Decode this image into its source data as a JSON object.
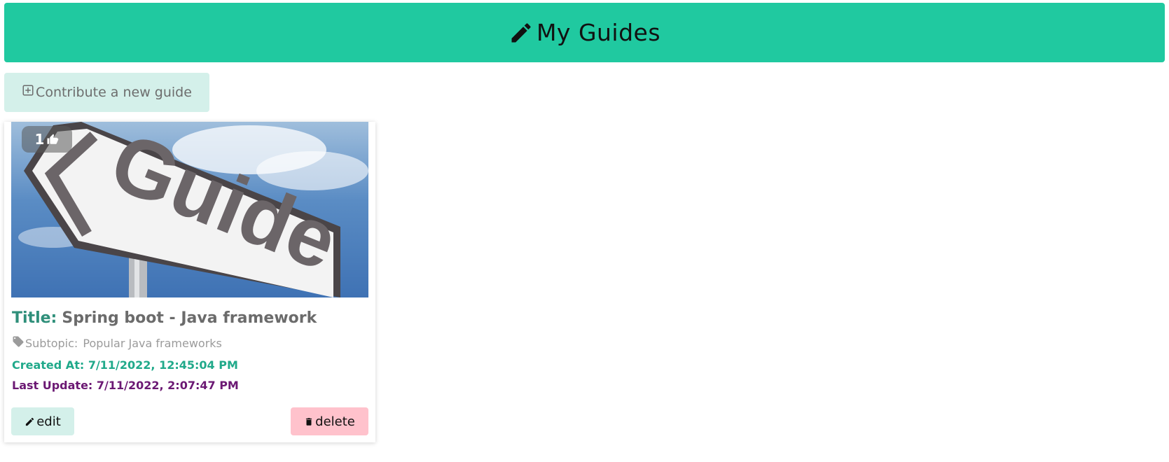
{
  "header": {
    "title": "My Guides",
    "icon": "pencil-icon",
    "background": "#20c9a0"
  },
  "actions": {
    "contribute_label": "Contribute a new guide",
    "contribute_icon": "plus-square-icon"
  },
  "guides": [
    {
      "image_text": "Guide",
      "likes": "1",
      "like_icon": "thumbs-up-icon",
      "title_key": "Title",
      "title_sep": ":",
      "title": "Spring boot - Java framework",
      "subtopic_label": "Subtopic:",
      "subtopic": "Popular Java frameworks",
      "created_label": "Created At:",
      "created_at": "7/11/2022, 12:45:04 PM",
      "updated_label": "Last Update:",
      "updated_at": "7/11/2022, 2:07:47 PM",
      "edit_label": "edit",
      "delete_label": "delete"
    }
  ],
  "colors": {
    "accent": "#20c9a0",
    "button_light": "#d4f0ea",
    "delete": "#ffc2cc",
    "created_text": "#20a98a",
    "updated_text": "#6b1873"
  }
}
